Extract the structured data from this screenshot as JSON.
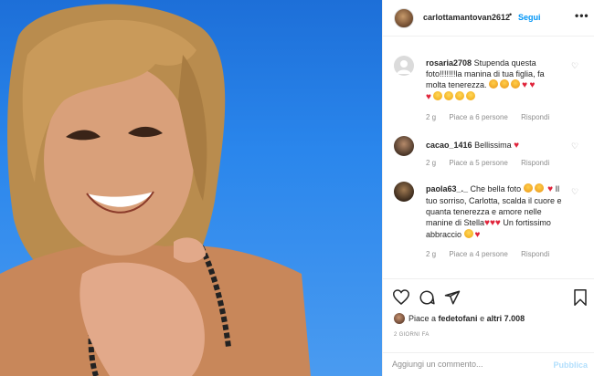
{
  "post": {
    "username": "carlottamantovan2612",
    "follow_label": "Segui",
    "separator": "•",
    "more_label": "•••"
  },
  "comments": [
    {
      "username": "rosaria2708",
      "text": "Stupenda questa foto!!!!!!!la manina di tua figlia, fa molta tenerezza.",
      "time": "2 g",
      "likes": "Piace a 6 persone",
      "reply": "Rispondi"
    },
    {
      "username": "cacao_1416",
      "text": "Bellissima",
      "time": "2 g",
      "likes": "Piace a 5 persone",
      "reply": "Rispondi"
    },
    {
      "username": "paola63_._",
      "text": "Che bella foto",
      "text2": "Il tuo sorriso, Carlotta, scalda il cuore e quanta tenerezza e amore nelle manine di Stella",
      "text3": "Un fortissimo abbraccio",
      "time": "2 g",
      "likes": "Piace a 4 persone",
      "reply": "Rispondi"
    }
  ],
  "likes": {
    "prefix": "Piace a",
    "user": "fedetofani",
    "and": "e",
    "others": "altri 7.008"
  },
  "date_label": "2 GIORNI FA",
  "add_comment": {
    "placeholder": "Aggiungi un commento...",
    "publish_label": "Pubblica"
  },
  "icons": [
    "heart-icon",
    "comment-icon",
    "share-icon",
    "bookmark-icon"
  ],
  "colors": {
    "link": "#0095f6",
    "heart": "#e0233a",
    "publish_disabled": "#b2dffc",
    "sky": "#2a86ec"
  }
}
